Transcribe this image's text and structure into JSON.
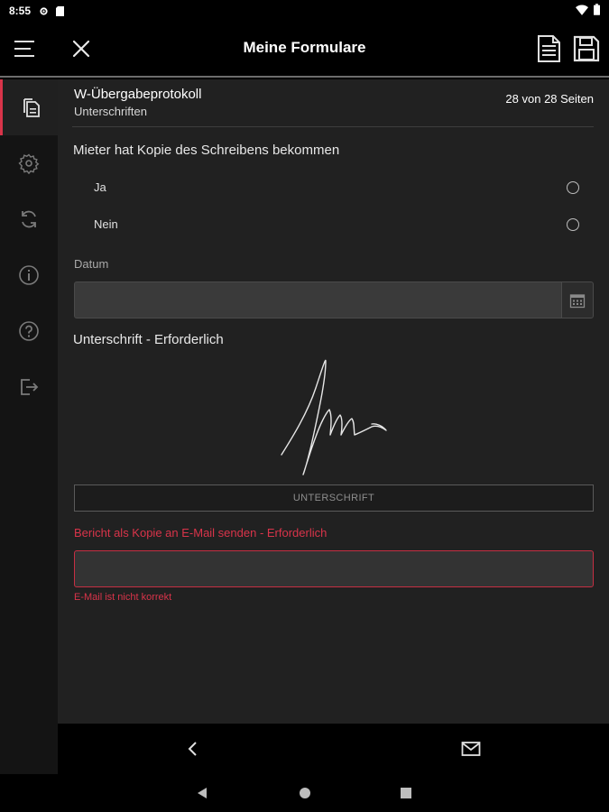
{
  "status_bar": {
    "time": "8:55"
  },
  "app_bar": {
    "title": "Meine Formulare"
  },
  "side_rail": {
    "items": [
      "documents-icon",
      "settings-icon",
      "sync-icon",
      "info-icon",
      "help-icon",
      "logout-icon"
    ],
    "active": "documents-icon"
  },
  "form": {
    "name": "W-Übergabeprotokoll",
    "section": "Unterschriften",
    "page_indicator": "28 von 28 Seiten"
  },
  "question": {
    "label": "Mieter hat Kopie des Schreibens bekommen",
    "options": [
      {
        "label": "Ja",
        "selected": false
      },
      {
        "label": "Nein",
        "selected": false
      }
    ]
  },
  "date_field": {
    "label": "Datum",
    "value": ""
  },
  "signature": {
    "label": "Unterschrift - Erforderlich",
    "button_label": "UNTERSCHRIFT"
  },
  "email_field": {
    "label": "Bericht als Kopie an E-Mail senden - Erforderlich",
    "value": "",
    "error": "E-Mail ist nicht korrekt"
  },
  "colors": {
    "accent": "#d9344a",
    "background": "#212121",
    "rail": "#141414",
    "bar": "#000000"
  }
}
